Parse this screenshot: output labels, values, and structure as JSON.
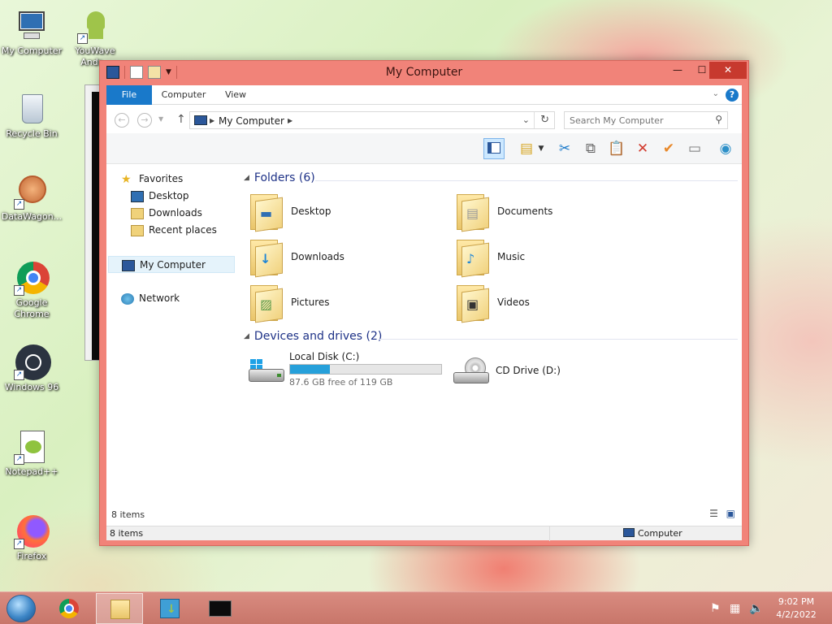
{
  "desktop": {
    "icons": [
      {
        "label": "My Computer"
      },
      {
        "label": "YouWave Andr..."
      },
      {
        "label": "Recycle Bin"
      },
      {
        "label": "DataWagon..."
      },
      {
        "label": "Google Chrome"
      },
      {
        "label": "Windows 96"
      },
      {
        "label": "Notepad++"
      },
      {
        "label": "Firefox"
      }
    ]
  },
  "window": {
    "title": "My Computer",
    "close_glyph": "✕",
    "max_glyph": "☐",
    "min_glyph": "—"
  },
  "ribbon": {
    "tabs": [
      {
        "label": "File"
      },
      {
        "label": "Computer"
      },
      {
        "label": "View"
      }
    ],
    "help_glyph": "?"
  },
  "address": {
    "crumb": "My Computer",
    "search_placeholder": "Search My Computer"
  },
  "nav": {
    "favorites": "Favorites",
    "desktop": "Desktop",
    "downloads": "Downloads",
    "recent": "Recent places",
    "my_computer": "My Computer",
    "network": "Network"
  },
  "content": {
    "folders_header": "Folders (6)",
    "folders": [
      {
        "label": "Desktop",
        "icon": "desktop-folder-icon"
      },
      {
        "label": "Documents",
        "icon": "documents-folder-icon"
      },
      {
        "label": "Downloads",
        "icon": "downloads-folder-icon"
      },
      {
        "label": "Music",
        "icon": "music-folder-icon"
      },
      {
        "label": "Pictures",
        "icon": "pictures-folder-icon"
      },
      {
        "label": "Videos",
        "icon": "videos-folder-icon"
      }
    ],
    "drives_header": "Devices and drives (2)",
    "drives": [
      {
        "label": "Local Disk (C:)",
        "free_text": "87.6 GB free of 119 GB",
        "used_fraction": 0.264
      },
      {
        "label": "CD Drive (D:)"
      }
    ]
  },
  "status": {
    "items_count": "8 items",
    "bar_left": "8 items",
    "bar_right": "Computer"
  },
  "taskbar": {
    "time": "9:02 PM",
    "date": "4/2/2022"
  },
  "colors": {
    "window_frame": "#f18379",
    "accent": "#1979ca",
    "header_text": "#1e3287",
    "disk_fill": "#26a0da"
  }
}
